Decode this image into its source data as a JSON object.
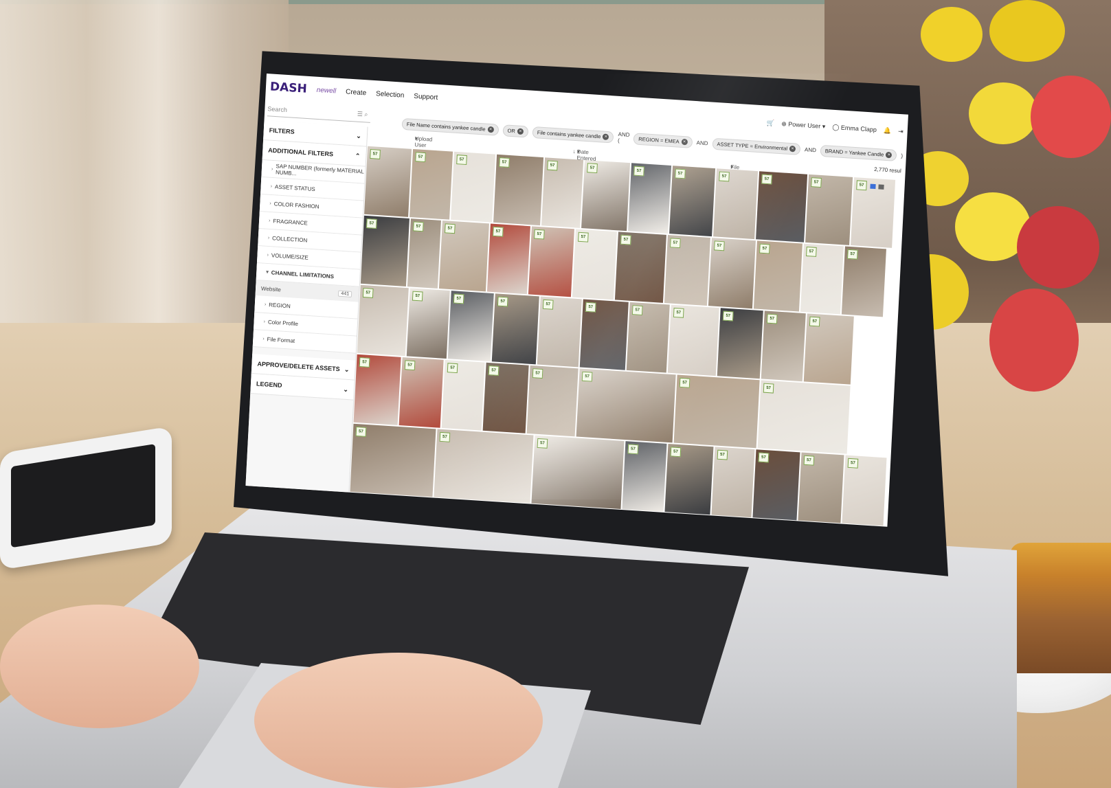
{
  "app": {
    "logo": "DASH",
    "logo_sub": "newell",
    "nav": [
      "Create",
      "Selection",
      "Support"
    ]
  },
  "search": {
    "placeholder": "Search"
  },
  "sidebar": {
    "filters_label": "FILTERS",
    "additional_filters_label": "ADDITIONAL FILTERS",
    "items": [
      "SAP NUMBER (formerly MATERIAL NUMB...",
      "ASSET STATUS",
      "COLOR FASHION",
      "FRAGRANCE",
      "COLLECTION",
      "VOLUME/SIZE"
    ],
    "channel_limitations": "CHANNEL LIMITATIONS",
    "website_option": "Website",
    "website_count": "441",
    "more_items": [
      "REGION",
      "Color Profile",
      "File Format"
    ],
    "approve_delete": "APPROVE/DELETE ASSETS",
    "legend": "LEGEND"
  },
  "filterbar": {
    "chips": [
      {
        "text": "File Name contains yankee candle"
      },
      {
        "text": "OR"
      },
      {
        "text": "File contains yankee candle"
      }
    ],
    "and1": "AND (",
    "region_chip": "REGION = EMEA",
    "and2": "AND",
    "asset_type_chip": "ASSET TYPE = Environmental",
    "and3": "AND",
    "brand_chip": "BRAND = Yankee Candle",
    "close_paren": ")"
  },
  "user": {
    "role": "Power User",
    "name": "Emma Clapp"
  },
  "sort": {
    "upload_user": "Upload User",
    "date_entered": "Date Entered",
    "file_size": "File Size"
  },
  "results": {
    "count": "2,770 resul"
  },
  "tiles": {
    "badge": "57",
    "colors": [
      "#d7cfc6",
      "#b9a58f",
      "#e6e1da",
      "#8f7d6a",
      "#c7bcb0",
      "#f0ece6",
      "#5a5d62",
      "#a89a88",
      "#dcd5cd",
      "#6b4e3c",
      "#c2b7a9",
      "#e9e4dd",
      "#3a3c40",
      "#9d8f7e",
      "#d1c8bd",
      "#b24a3c",
      "#cfc4b7",
      "#edeae4",
      "#7c6f62",
      "#bdb2a5"
    ]
  },
  "colors": {
    "brand": "#3a1f79",
    "accent": "#3b6fd8",
    "badge_border": "#7aa24a"
  }
}
